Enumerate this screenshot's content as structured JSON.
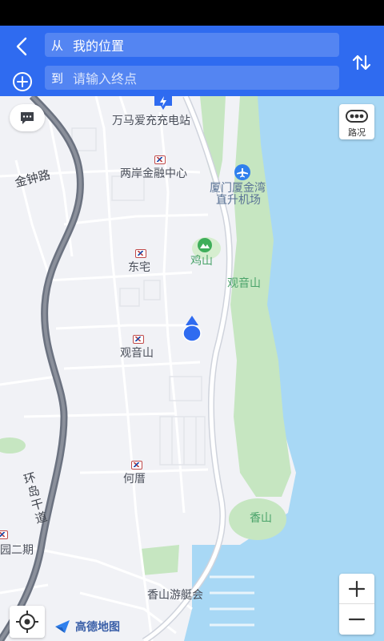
{
  "route": {
    "from_prefix": "从",
    "from_value": "我的位置",
    "to_prefix": "到",
    "to_placeholder": "请输入终点"
  },
  "map": {
    "traffic_label": "路况",
    "brand_name": "高德地图",
    "labels": {
      "charging_station": "万马爱充充电站",
      "jinzhong_road": "金钟路",
      "liangan_finance": "两岸金融中心",
      "heliport_line1": "厦门厦金湾",
      "heliport_line2": "直升机场",
      "jishan": "鸡山",
      "dongzhai": "东宅",
      "guanyinshan_area": "观音山",
      "guanyinshan_station": "观音山",
      "hecuo": "何厝",
      "huandao_road": "环岛干道",
      "yuan_phase2": "园二期",
      "xiangshan": "香山",
      "xiangshan_yacht": "香山游艇会"
    },
    "colors": {
      "water": "#a8d8f5",
      "green": "#c6e6c1",
      "highway": "#6b7280",
      "accent": "#2f6bf0"
    }
  }
}
